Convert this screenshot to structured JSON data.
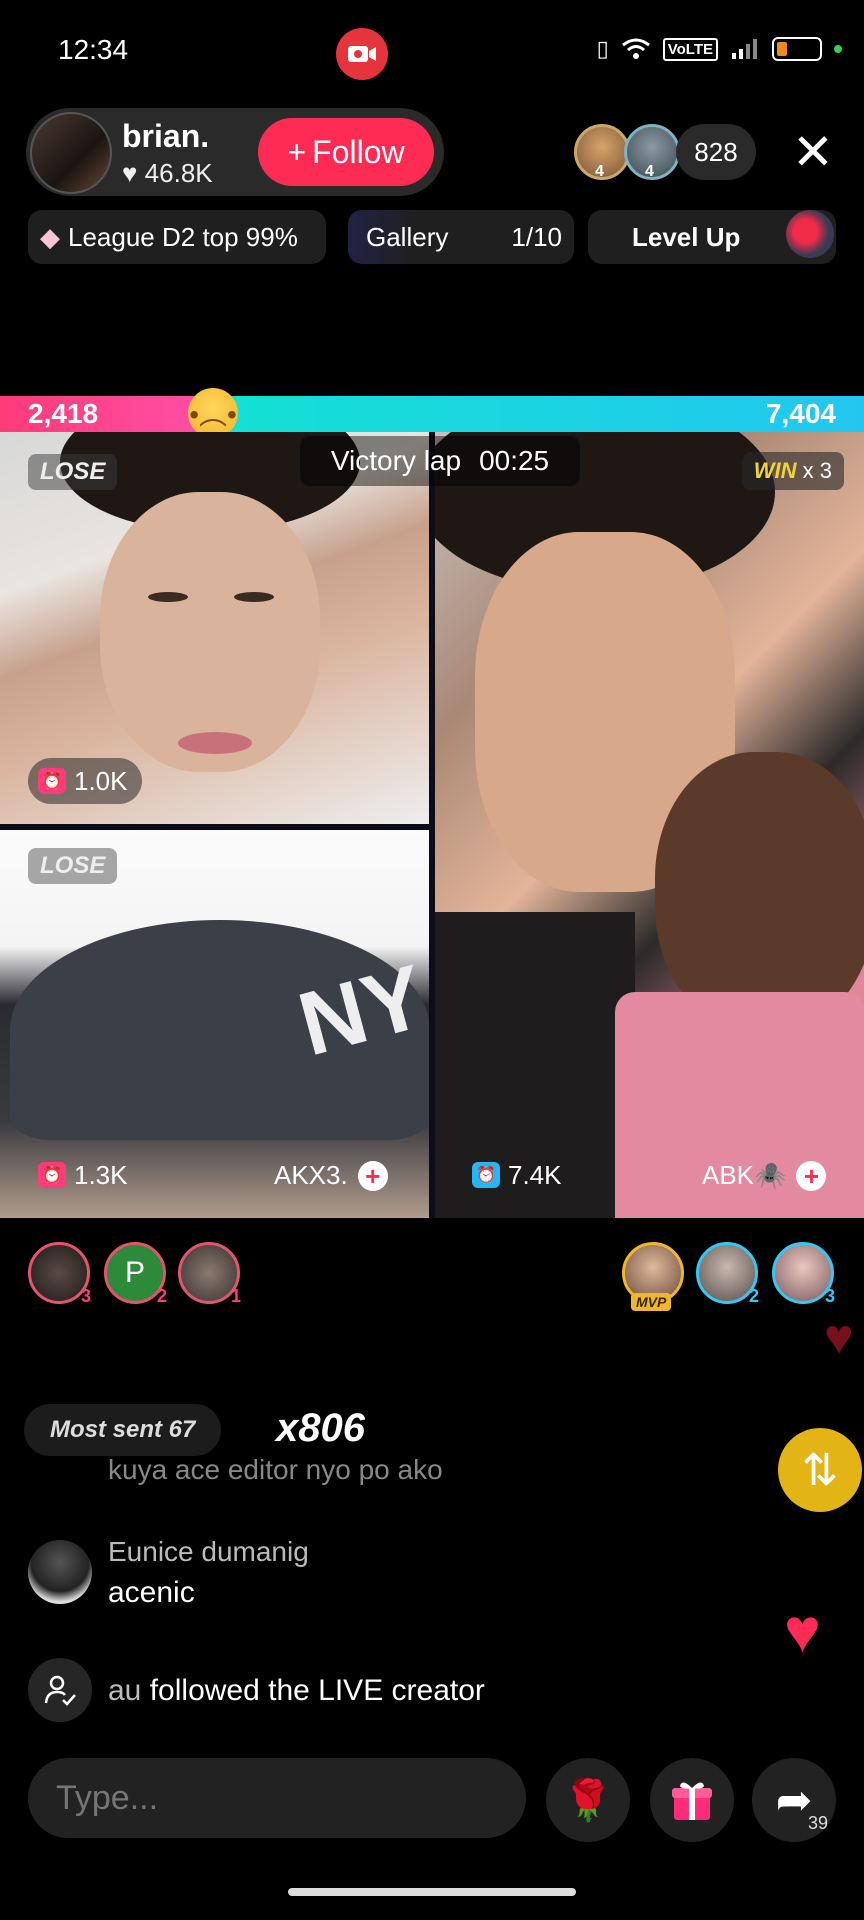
{
  "status_bar": {
    "time": "12:34",
    "volte": "VoLTE"
  },
  "host": {
    "name": "brian.",
    "likes": "46.8K",
    "follow_label": "Follow"
  },
  "viewers": {
    "avatar1_rank": "4",
    "avatar2_rank": "4",
    "count": "828"
  },
  "chips": {
    "league": "League D2 top 99%",
    "gallery_label": "Gallery",
    "gallery_count": "1/10",
    "level_up": "Level Up"
  },
  "battle": {
    "score_left": "2,418",
    "score_right": "7,404",
    "score_left_fraction": 0.246,
    "victory_label": "Victory lap",
    "victory_time": "00:25",
    "lose_label": "LOSE",
    "win_label": "WIN",
    "win_multiplier": "x 3"
  },
  "tiles": {
    "top_left_score": "1.0K",
    "bottom_left_score": "1.3K",
    "bottom_left_name": "AKX3.",
    "right_score": "7.4K",
    "right_name": "ABK🕷️"
  },
  "supporters": {
    "left": [
      {
        "rank": "3",
        "initial": ""
      },
      {
        "rank": "2",
        "initial": "P"
      },
      {
        "rank": "1",
        "initial": ""
      }
    ],
    "right": [
      {
        "rank": "MVP"
      },
      {
        "rank": "2"
      },
      {
        "rank": "3"
      }
    ]
  },
  "gift_banner": {
    "most_sent": "Most sent 67",
    "multiplier": "x806"
  },
  "chat": {
    "faded_message": "kuya ace editor nyo po ako",
    "user": "Eunice dumanig",
    "message": "acenic",
    "follow_user": "au",
    "follow_text": "followed the LIVE creator"
  },
  "input": {
    "placeholder": "Type...",
    "share_count": "39"
  },
  "colors": {
    "accent": "#fe2c55",
    "left_team": "#ff3b7a",
    "right_team": "#22c7f0",
    "win_gold": "#f0d23c"
  },
  "icons": [
    "record-icon",
    "vibrate-icon",
    "wifi-icon",
    "signal-icon",
    "battery-icon",
    "heart-icon",
    "plus-icon",
    "close-icon",
    "diamond-icon",
    "alarm-icon",
    "repost-icon",
    "follow-user-icon",
    "rose-icon",
    "gift-icon",
    "share-icon"
  ]
}
